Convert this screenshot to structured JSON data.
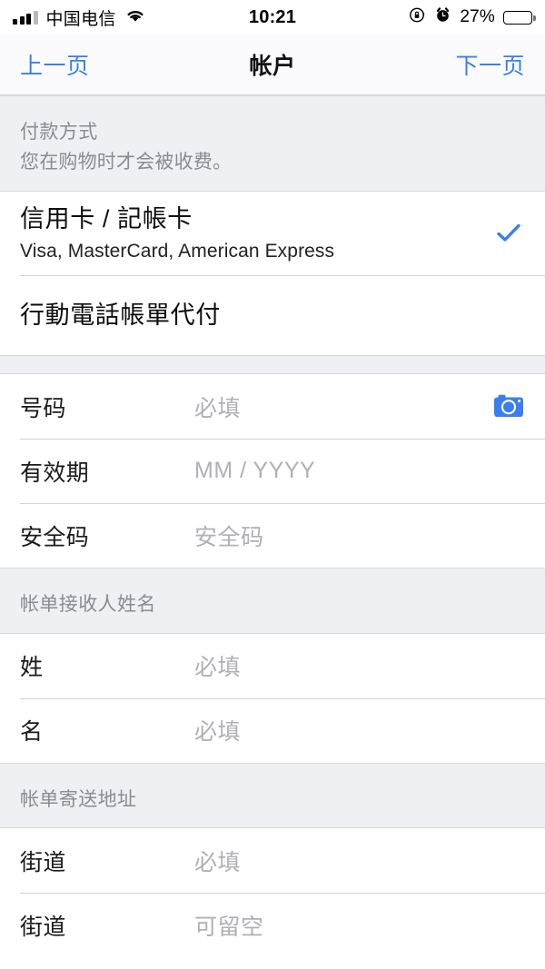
{
  "status_bar": {
    "carrier": "中国电信",
    "signal_icon": "signal-bars-icon",
    "wifi_icon": "wifi-icon",
    "time": "10:21",
    "rotation_lock_icon": "rotation-lock-icon",
    "alarm_icon": "alarm-clock-icon",
    "battery_percent": "27%",
    "battery_level": 27,
    "battery_icon": "battery-icon"
  },
  "nav_bar": {
    "back_label": "上一页",
    "title": "帐户",
    "next_label": "下一页",
    "accent_color": "#3b7ef0"
  },
  "sections": [
    {
      "header_title": "付款方式",
      "header_subtitle": "您在购物时才会被收费。",
      "options": [
        {
          "title": "信用卡 / 記帳卡",
          "subtitle": "Visa, MasterCard, American Express",
          "selected": true,
          "check_icon": "checkmark-icon"
        },
        {
          "title": "行動電話帳單代付",
          "selected": false
        }
      ]
    },
    {
      "fields": [
        {
          "label": "号码",
          "placeholder": "必填",
          "value": "",
          "trailing_icon": "camera-icon"
        },
        {
          "label": "有效期",
          "placeholder": "MM / YYYY",
          "value": ""
        },
        {
          "label": "安全码",
          "placeholder": "安全码",
          "value": ""
        }
      ]
    },
    {
      "header_title": "帐单接收人姓名",
      "fields": [
        {
          "label": "姓",
          "placeholder": "必填",
          "value": ""
        },
        {
          "label": "名",
          "placeholder": "必填",
          "value": ""
        }
      ]
    },
    {
      "header_title": "帐单寄送地址",
      "fields": [
        {
          "label": "街道",
          "placeholder": "必填",
          "value": ""
        },
        {
          "label": "街道",
          "placeholder": "可留空",
          "value": ""
        }
      ]
    }
  ],
  "colors": {
    "accent_blue": "#3b7ef0",
    "group_background": "#eff0f4",
    "row_background": "#ffffff",
    "placeholder_gray": "#b0b0b5",
    "header_gray": "#8b8b92"
  }
}
